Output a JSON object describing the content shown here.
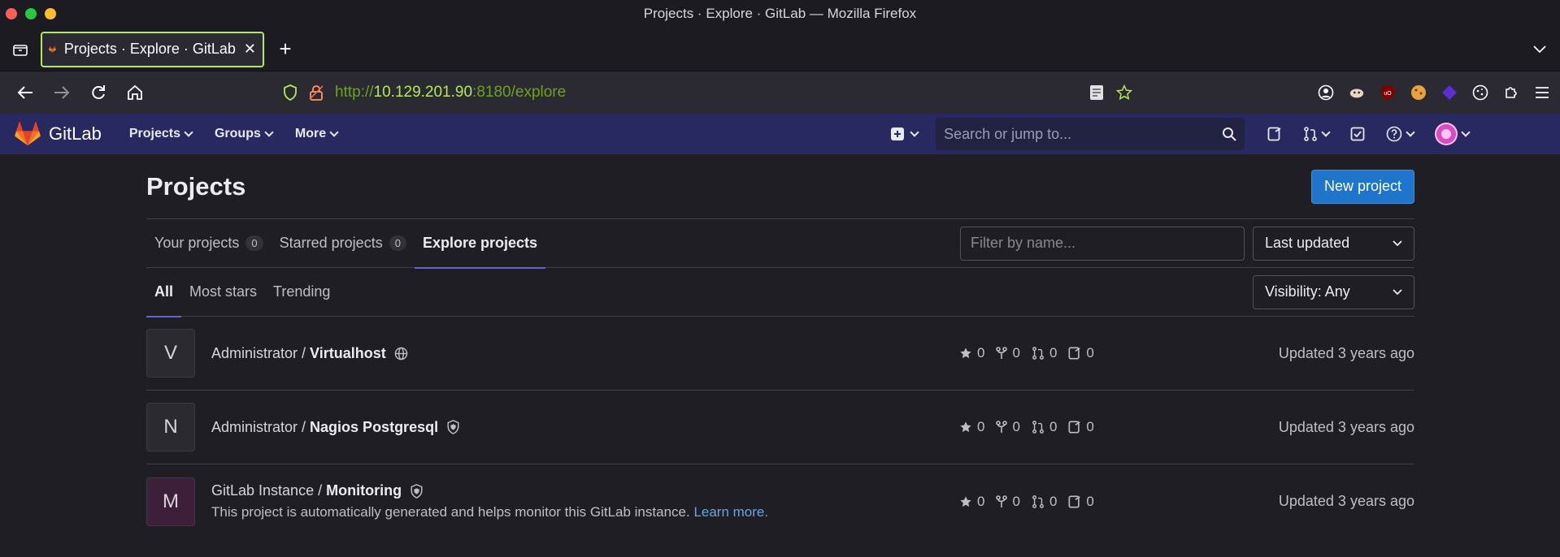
{
  "window": {
    "title": "Projects · Explore · GitLab — Mozilla Firefox"
  },
  "browser": {
    "tab_title": "Projects · Explore · GitLab",
    "url_prefix": "http://",
    "url_host": "10.129.201.90",
    "url_suffix": ":8180/explore"
  },
  "gitlab": {
    "brand": "GitLab",
    "menu": [
      "Projects",
      "Groups",
      "More"
    ],
    "search_placeholder": "Search or jump to..."
  },
  "page": {
    "title": "Projects",
    "new_project": "New project",
    "tabs": [
      {
        "label": "Your projects",
        "count": "0"
      },
      {
        "label": "Starred projects",
        "count": "0"
      },
      {
        "label": "Explore projects"
      }
    ],
    "filter_placeholder": "Filter by name...",
    "sort": "Last updated",
    "subtabs": [
      "All",
      "Most stars",
      "Trending"
    ],
    "visibility": "Visibility: Any"
  },
  "projects": [
    {
      "initial": "V",
      "namespace": "Administrator / ",
      "name": "Virtualhost",
      "visibility_icon": "globe-icon",
      "stars": "0",
      "forks": "0",
      "merge_requests": "0",
      "issues": "0",
      "updated": "Updated 3 years ago"
    },
    {
      "initial": "N",
      "namespace": "Administrator / ",
      "name": "Nagios Postgresql",
      "visibility_icon": "shield-icon",
      "stars": "0",
      "forks": "0",
      "merge_requests": "0",
      "issues": "0",
      "updated": "Updated 3 years ago"
    },
    {
      "initial": "M",
      "namespace": "GitLab Instance / ",
      "name": "Monitoring",
      "visibility_icon": "shield-icon",
      "description": "This project is automatically generated and helps monitor this GitLab instance.",
      "learn_more": "Learn more.",
      "stars": "0",
      "forks": "0",
      "merge_requests": "0",
      "issues": "0",
      "updated": "Updated 3 years ago"
    }
  ]
}
